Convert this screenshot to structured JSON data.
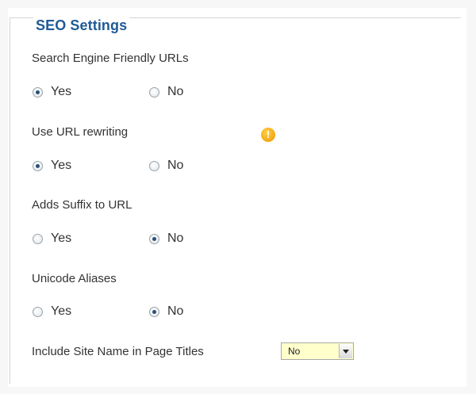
{
  "section": {
    "title": "SEO Settings"
  },
  "settings": [
    {
      "label": "Search Engine Friendly URLs",
      "options": [
        {
          "label": "Yes",
          "checked": true
        },
        {
          "label": "No",
          "checked": false
        }
      ]
    },
    {
      "label": "Use URL rewriting",
      "warning_icon": "warning-icon",
      "options": [
        {
          "label": "Yes",
          "checked": true
        },
        {
          "label": "No",
          "checked": false
        }
      ]
    },
    {
      "label": "Adds Suffix to URL",
      "options": [
        {
          "label": "Yes",
          "checked": false
        },
        {
          "label": "No",
          "checked": true
        }
      ]
    },
    {
      "label": "Unicode Aliases",
      "options": [
        {
          "label": "Yes",
          "checked": false
        },
        {
          "label": "No",
          "checked": true
        }
      ]
    }
  ],
  "site_name_in_titles": {
    "label": "Include Site Name in Page Titles",
    "selected": "No"
  },
  "colors": {
    "legend": "#1f5a96",
    "warning": "#f3a712",
    "select_background": "#ffffcc"
  }
}
